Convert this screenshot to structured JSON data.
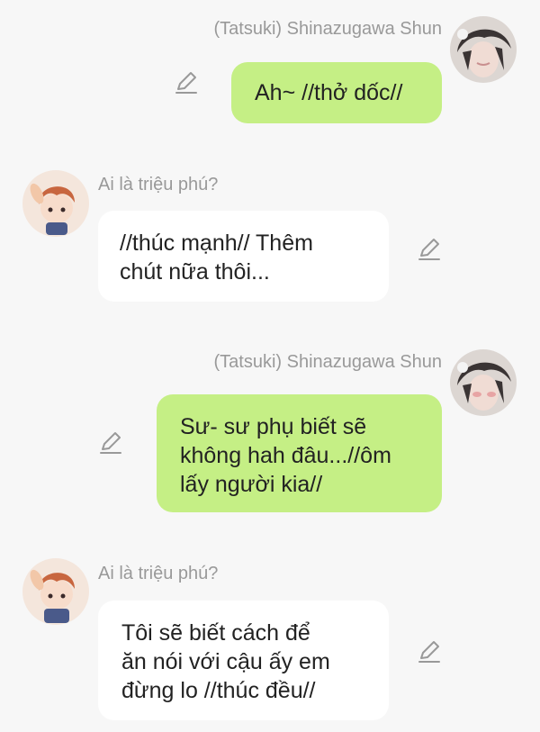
{
  "colors": {
    "background": "#f7f7f7",
    "my_bubble": "#c5ef85",
    "their_bubble": "#ffffff",
    "sender_name": "#999999",
    "icon": "#999999"
  },
  "messages": [
    {
      "sender": "(Tatsuki) Shinazugawa Shun",
      "side": "right",
      "avatar": "dark-haired-character-avatar",
      "lines": [
        "Ah~ //thở dốc//"
      ],
      "action_icon": "pencil-edit-icon"
    },
    {
      "sender": "Ai là triệu phú?",
      "side": "left",
      "avatar": "chibi-redhead-avatar",
      "lines": [
        "//thúc mạnh// Thêm",
        "chút nữa thôi..."
      ],
      "action_icon": "pencil-edit-icon"
    },
    {
      "sender": "(Tatsuki) Shinazugawa Shun",
      "side": "right",
      "avatar": "dark-haired-character-avatar",
      "lines": [
        "Sư- sư phụ biết sẽ",
        "không hah đâu...//ôm",
        "lấy người kia//"
      ],
      "action_icon": "pencil-edit-icon"
    },
    {
      "sender": "Ai là triệu phú?",
      "side": "left",
      "avatar": "chibi-redhead-avatar",
      "lines": [
        "Tôi sẽ biết cách để",
        "ăn nói với cậu ấy em",
        "đừng lo //thúc đều//"
      ],
      "action_icon": "pencil-edit-icon"
    }
  ]
}
